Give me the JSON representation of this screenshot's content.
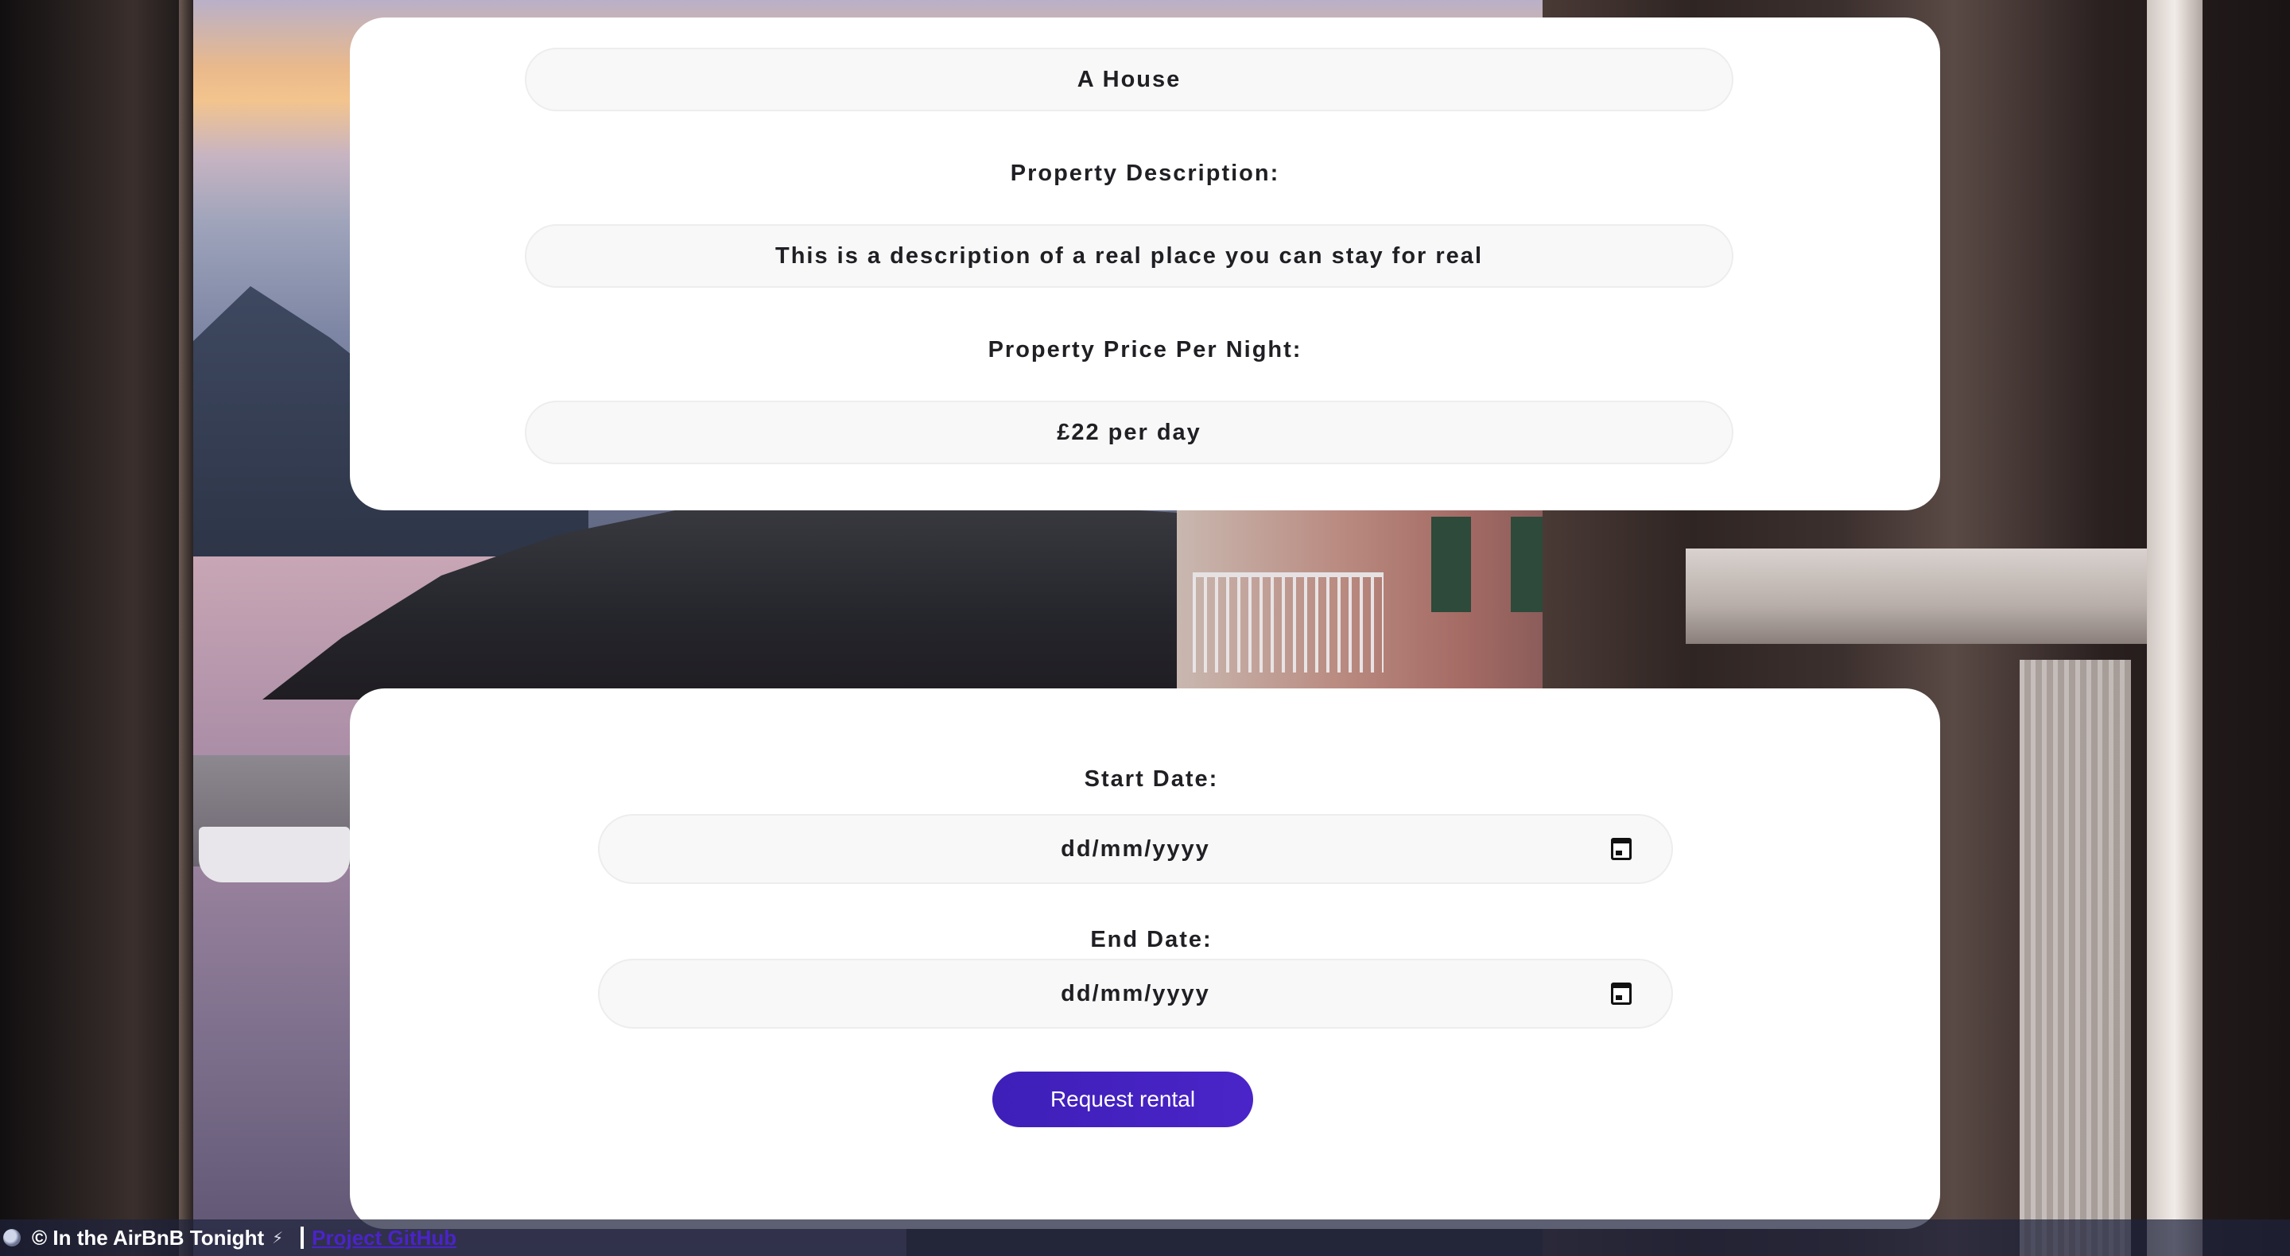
{
  "property": {
    "name_value": "A House",
    "description_label": "Property Description:",
    "description_value": "This is a description of a real place you can stay for real",
    "price_label": "Property Price Per Night:",
    "price_value": "£22 per day"
  },
  "booking": {
    "start_label": "Start Date:",
    "start_value": "dd/mm/yyyy",
    "end_label": "End Date:",
    "end_value": "dd/mm/yyyy",
    "submit_label": "Request rental"
  },
  "footer": {
    "copyright": "© In the AirBnB Tonight",
    "bolt": "⚡",
    "link_label": "Project GitHub"
  },
  "colors": {
    "accent": "#4a24c8",
    "card": "#ffffff",
    "pill": "#f8f8f8"
  }
}
